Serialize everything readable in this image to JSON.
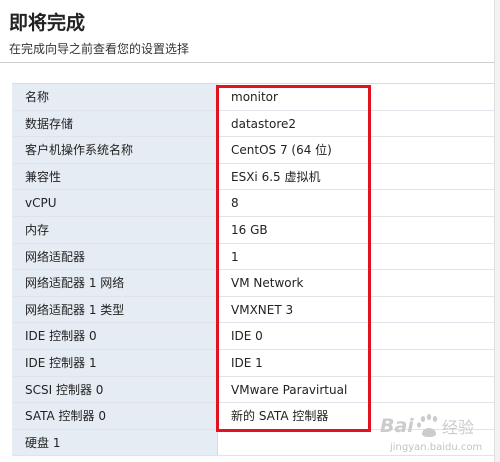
{
  "header": {
    "title": "即将完成",
    "subtitle": "在完成向导之前查看您的设置选择"
  },
  "summary": {
    "rows": [
      {
        "label": "名称",
        "value": "monitor"
      },
      {
        "label": "数据存储",
        "value": "datastore2"
      },
      {
        "label": "客户机操作系统名称",
        "value": "CentOS 7 (64 位)"
      },
      {
        "label": "兼容性",
        "value": "ESXi 6.5 虚拟机"
      },
      {
        "label": "vCPU",
        "value": "8"
      },
      {
        "label": "内存",
        "value": "16 GB"
      },
      {
        "label": "网络适配器",
        "value": "1"
      },
      {
        "label": "网络适配器 1 网络",
        "value": "VM Network"
      },
      {
        "label": "网络适配器 1 类型",
        "value": "VMXNET 3"
      },
      {
        "label": "IDE 控制器 0",
        "value": "IDE 0"
      },
      {
        "label": "IDE 控制器 1",
        "value": "IDE 1"
      },
      {
        "label": "SCSI 控制器 0",
        "value": "VMware Paravirtual"
      },
      {
        "label": "SATA 控制器 0",
        "value": "新的 SATA 控制器"
      },
      {
        "label": "硬盘 1",
        "value": ""
      }
    ]
  },
  "watermark": {
    "logo_text": "Bai 经验",
    "url": "jingyan.baidu.com"
  },
  "colors": {
    "highlight_border": "#e0131f",
    "label_background": "#e6ecf3"
  }
}
